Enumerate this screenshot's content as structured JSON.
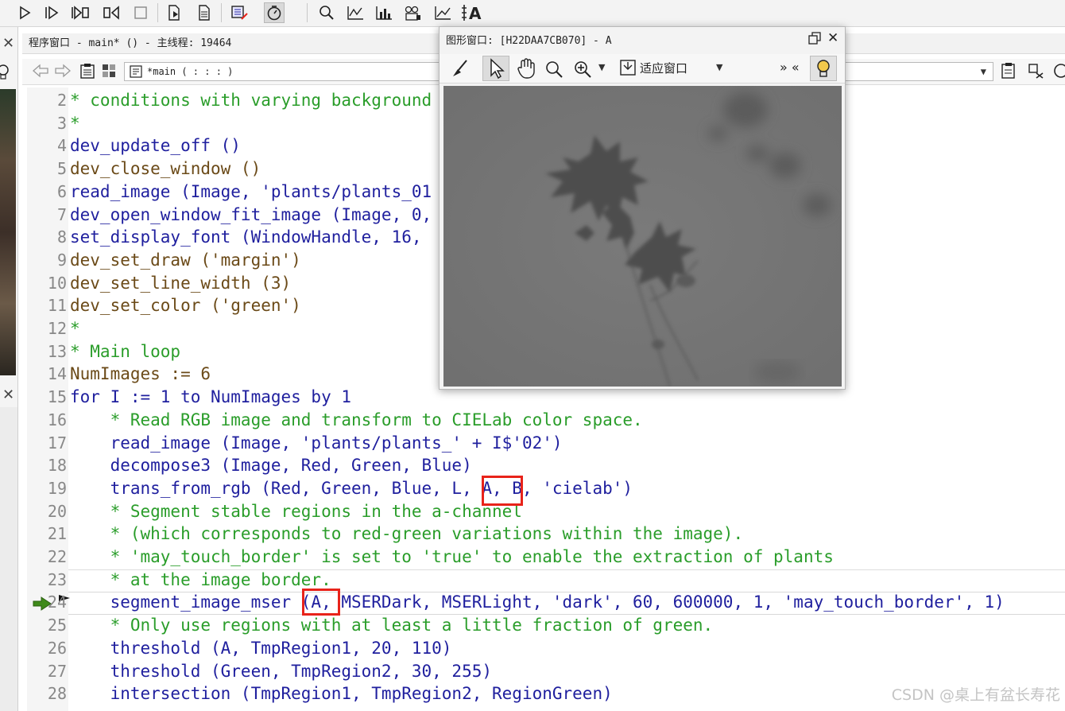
{
  "toolbar": {
    "icons": [
      "run-icon",
      "step-over-icon",
      "step-into-icon",
      "step-out-icon",
      "stop-icon",
      "insert-icon",
      "reset-icon",
      "activate-icon",
      "profiler-icon",
      "zoom-icon",
      "line-profile-icon",
      "histogram-icon",
      "gray-histogram-icon",
      "feature-inspect-icon",
      "ocr-icon"
    ]
  },
  "program_window": {
    "title": "程序窗口 - main* () - 主线程: 19464",
    "procedure_select": "*main ( : : : )"
  },
  "graphics_window": {
    "title": "图形窗口: [H22DAA7CB070] - A",
    "fit_label": "适应窗口",
    "more_label": "» «"
  },
  "code": {
    "lines": [
      {
        "n": "2",
        "text": "* conditions with varying background",
        "cls": "c-green"
      },
      {
        "n": "3",
        "text": "*",
        "cls": "c-green"
      },
      {
        "n": "4",
        "text": "dev_update_off ()",
        "cls": "c-blue"
      },
      {
        "n": "5",
        "text": "dev_close_window ()",
        "cls": "c-brown"
      },
      {
        "n": "6",
        "text": "read_image (Image, 'plants/plants_01",
        "cls": "c-blue"
      },
      {
        "n": "7",
        "text": "dev_open_window_fit_image (Image, 0,",
        "cls": "c-blue"
      },
      {
        "n": "8",
        "text": "set_display_font (WindowHandle, 16,",
        "cls": "c-blue"
      },
      {
        "n": "9",
        "text": "dev_set_draw ('margin')",
        "cls": "c-brown"
      },
      {
        "n": "10",
        "text": "dev_set_line_width (3)",
        "cls": "c-brown"
      },
      {
        "n": "11",
        "text": "dev_set_color ('green')",
        "cls": "c-brown"
      },
      {
        "n": "12",
        "text": "*",
        "cls": "c-green"
      },
      {
        "n": "13",
        "text": "* Main loop",
        "cls": "c-green"
      },
      {
        "n": "14",
        "text": "NumImages := 6",
        "cls": "c-brown"
      },
      {
        "n": "15",
        "text": "for I := 1 to NumImages by 1",
        "cls": "c-blue"
      },
      {
        "n": "16",
        "text": "    * Read RGB image and transform to CIELab color space.",
        "cls": "c-green"
      },
      {
        "n": "17",
        "text": "    read_image (Image, 'plants/plants_' + I$'02')",
        "cls": "c-blue"
      },
      {
        "n": "18",
        "text": "    decompose3 (Image, Red, Green, Blue)",
        "cls": "c-blue"
      },
      {
        "n": "19",
        "text": "    trans_from_rgb (Red, Green, Blue, L, A, B, 'cielab')",
        "cls": "c-blue"
      },
      {
        "n": "20",
        "text": "    * Segment stable regions in the a-channel",
        "cls": "c-green"
      },
      {
        "n": "21",
        "text": "    * (which corresponds to red-green variations within the image).",
        "cls": "c-green"
      },
      {
        "n": "22",
        "text": "    * 'may_touch_border' is set to 'true' to enable the extraction of plants",
        "cls": "c-green"
      },
      {
        "n": "23",
        "text": "    * at the image border.",
        "cls": "c-green"
      },
      {
        "n": "24",
        "text": "    segment_image_mser (A, MSERDark, MSERLight, 'dark', 60, 600000, 1, 'may_touch_border', 1)",
        "cls": "c-blue"
      },
      {
        "n": "25",
        "text": "    * Only use regions with at least a little fraction of green.",
        "cls": "c-green"
      },
      {
        "n": "26",
        "text": "    threshold (A, TmpRegion1, 20, 110)",
        "cls": "c-blue"
      },
      {
        "n": "27",
        "text": "    threshold (Green, TmpRegion2, 30, 255)",
        "cls": "c-blue"
      },
      {
        "n": "28",
        "text": "    intersection (TmpRegion1, TmpRegion2, RegionGreen)",
        "cls": "c-blue"
      }
    ]
  },
  "watermark": "CSDN @桌上有盆长寿花",
  "colors": {
    "highlight": "#e8231a",
    "comment": "#2a9d2a",
    "operator": "#1f1f9e",
    "control": "#6b4a18"
  }
}
